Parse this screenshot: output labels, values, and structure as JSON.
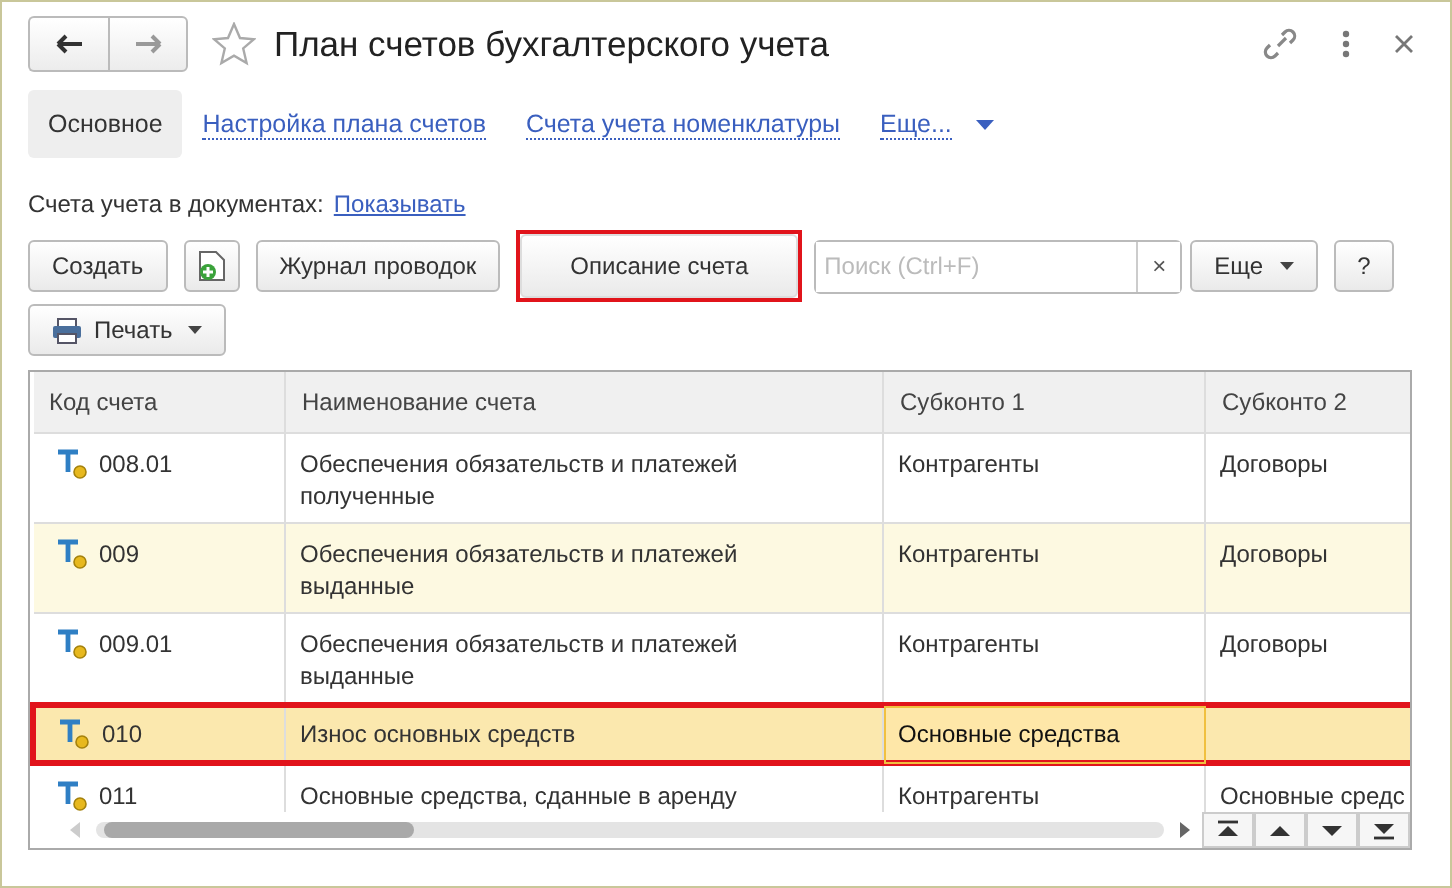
{
  "window": {
    "title": "План счетов бухгалтерского учета"
  },
  "tabs": [
    {
      "label": "Основное",
      "selected": true
    },
    {
      "label": "Настройка плана счетов",
      "selected": false
    },
    {
      "label": "Счета учета номенклатуры",
      "selected": false
    },
    {
      "label": "Еще...",
      "selected": false,
      "kind": "more"
    }
  ],
  "accounts_in_documents": {
    "label": "Счета учета в документах:",
    "link": "Показывать"
  },
  "toolbar": [
    {
      "kind": "text",
      "label": "Создать",
      "marked": false
    },
    {
      "kind": "icon",
      "marked": false
    },
    {
      "kind": "text",
      "label": "Журнал проводок",
      "marked": false
    },
    {
      "kind": "text",
      "label": "Описание счета",
      "marked": true
    },
    {
      "kind": "search",
      "placeholder": "Поиск (Ctrl+F)",
      "clear": "×"
    },
    {
      "kind": "menu",
      "label": "Еще",
      "marked": false
    },
    {
      "kind": "text",
      "label": "?",
      "marked": false
    }
  ],
  "print_button": {
    "label": "Печать"
  },
  "table": {
    "columns": [
      "Код счета",
      "Наименование счета",
      "Субконто 1",
      "Субконто 2"
    ],
    "rows": [
      {
        "code": "008.01",
        "name": "Обеспечения обязательств и платежей полученные",
        "subkonto_1": "Контрагенты",
        "subkonto_2": "Договоры",
        "selected": false,
        "shaded": false,
        "marked": false,
        "subkonto_1_focused": false
      },
      {
        "code": "009",
        "name": "Обеспечения обязательств и платежей выданные",
        "subkonto_1": "Контрагенты",
        "subkonto_2": "Договоры",
        "selected": false,
        "shaded": true,
        "marked": false,
        "subkonto_1_focused": false
      },
      {
        "code": "009.01",
        "name": "Обеспечения обязательств и платежей выданные",
        "subkonto_1": "Контрагенты",
        "subkonto_2": "Договоры",
        "selected": false,
        "shaded": false,
        "marked": false,
        "subkonto_1_focused": false
      },
      {
        "code": "010",
        "name": "Износ основных средств",
        "subkonto_1": "Основные средства",
        "selected": true,
        "shaded": false,
        "marked": true,
        "subkonto_1_focused": true
      },
      {
        "code": "011",
        "name": "Основные средства, сданные в аренду",
        "subkonto_1": "Контрагенты",
        "subkonto_2": "Основные средс",
        "selected": false,
        "shaded": false,
        "marked": false,
        "subkonto_1_focused": false
      }
    ]
  }
}
